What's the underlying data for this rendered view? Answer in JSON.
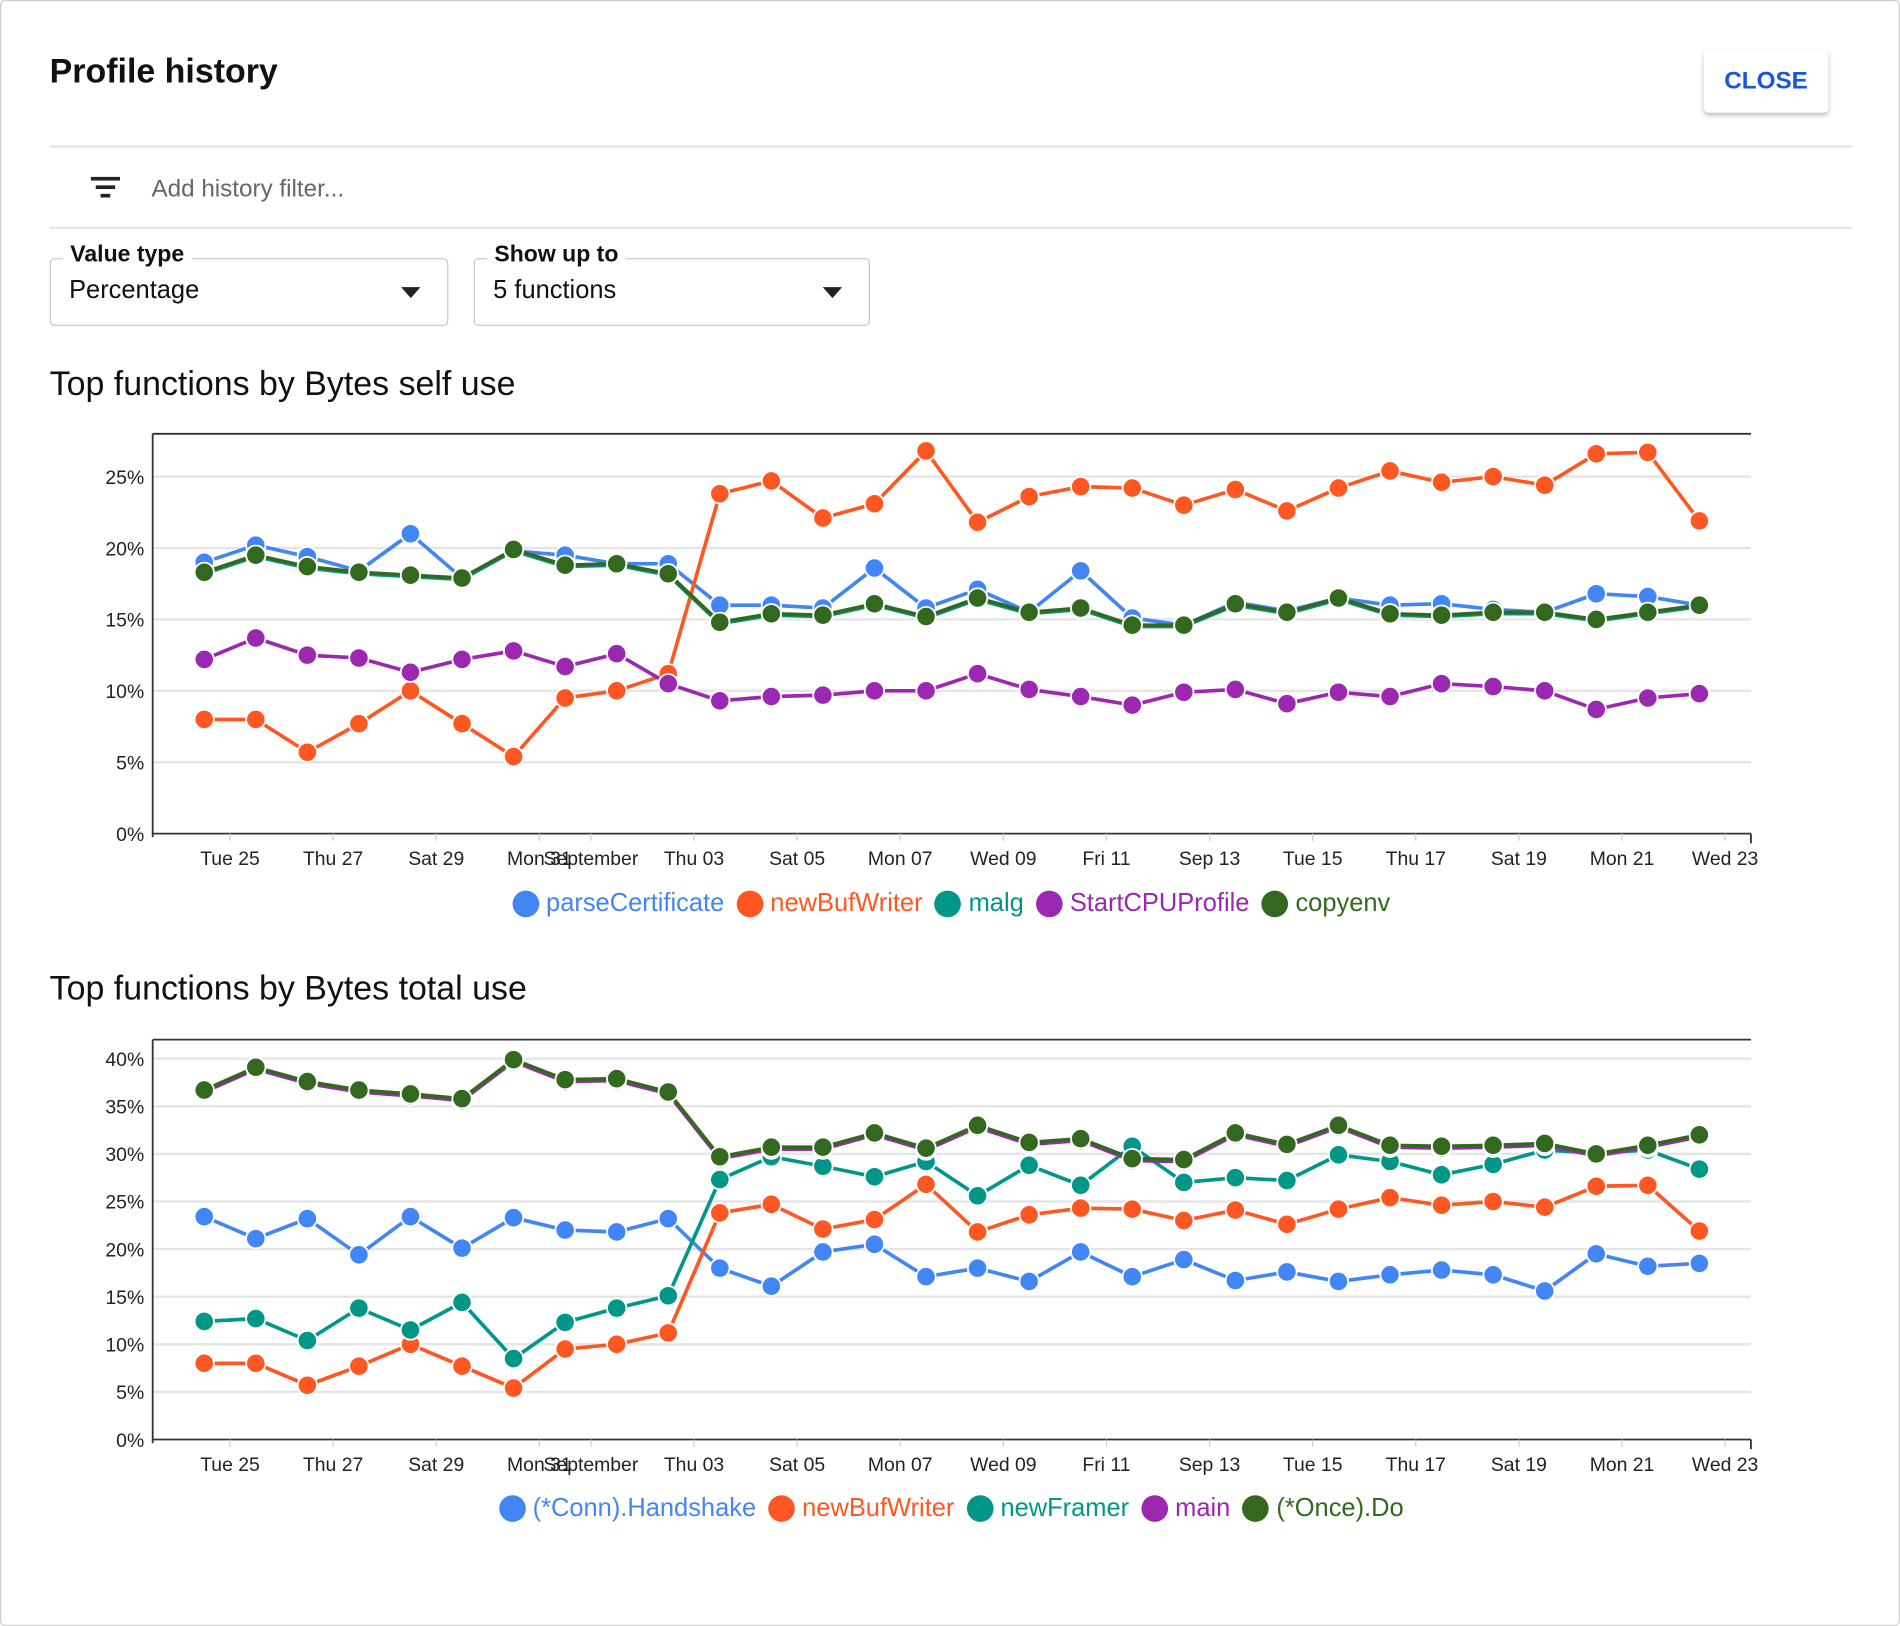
{
  "header": {
    "title": "Profile history",
    "close_label": "CLOSE"
  },
  "filter": {
    "icon": "filter-list-icon",
    "placeholder": "Add history filter..."
  },
  "controls": {
    "value_type": {
      "label": "Value type",
      "value": "Percentage"
    },
    "show_up_to": {
      "label": "Show up to",
      "value": "5 functions"
    }
  },
  "chart_data": [
    {
      "type": "line",
      "title": "Top functions by Bytes self use",
      "x": [
        "Aug 24",
        "Aug 25",
        "Aug 26",
        "Aug 27",
        "Aug 28",
        "Aug 29",
        "Aug 30",
        "Aug 31",
        "Sep 01",
        "Sep 02",
        "Sep 03",
        "Sep 04",
        "Sep 05",
        "Sep 06",
        "Sep 07",
        "Sep 08",
        "Sep 09",
        "Sep 10",
        "Sep 11",
        "Sep 12",
        "Sep 13",
        "Sep 14",
        "Sep 15",
        "Sep 16",
        "Sep 17",
        "Sep 18",
        "Sep 19",
        "Sep 20",
        "Sep 21",
        "Sep 22"
      ],
      "xticks": [
        "Tue 25",
        "Thu 27",
        "Sat 29",
        "Mon 31",
        "September",
        "Thu 03",
        "Sat 05",
        "Mon 07",
        "Wed 09",
        "Fri 11",
        "Sep 13",
        "Tue 15",
        "Thu 17",
        "Sat 19",
        "Mon 21",
        "Wed 23"
      ],
      "yticks": [
        "0%",
        "5%",
        "10%",
        "15%",
        "20%",
        "25%"
      ],
      "ylim": [
        0,
        28
      ],
      "grid": true,
      "legend": "bottom",
      "series": [
        {
          "name": "parseCertificate",
          "color": "#4285f4",
          "values": [
            19.0,
            20.2,
            19.4,
            18.4,
            21.0,
            17.9,
            19.8,
            19.5,
            18.9,
            18.9,
            16.0,
            16.0,
            15.8,
            18.6,
            15.8,
            17.1,
            15.5,
            18.4,
            15.1,
            14.6,
            16.2,
            15.6,
            16.5,
            16.0,
            16.1,
            15.7,
            15.5,
            16.8,
            16.6,
            16.0
          ]
        },
        {
          "name": "newBufWriter",
          "color": "#ff5722",
          "values": [
            8.0,
            8.0,
            5.7,
            7.7,
            10.0,
            7.7,
            5.4,
            9.5,
            10.0,
            11.2,
            23.8,
            24.7,
            22.1,
            23.1,
            26.8,
            21.8,
            23.6,
            24.3,
            24.2,
            23.0,
            24.1,
            22.6,
            24.2,
            25.4,
            24.6,
            25.0,
            24.4,
            26.6,
            26.7,
            21.9
          ]
        },
        {
          "name": "malg",
          "color": "#009688",
          "values": [
            18.2,
            19.4,
            18.6,
            18.2,
            18.0,
            17.8,
            19.8,
            18.7,
            18.8,
            18.1,
            14.7,
            15.3,
            15.2,
            16.0,
            15.1,
            16.4,
            15.4,
            15.7,
            14.5,
            14.5,
            16.0,
            15.4,
            16.4,
            15.3,
            15.2,
            15.4,
            15.4,
            14.9,
            15.4,
            15.9
          ]
        },
        {
          "name": "StartCPUProfile",
          "color": "#9c27b0",
          "values": [
            12.2,
            13.7,
            12.5,
            12.3,
            11.3,
            12.2,
            12.8,
            11.7,
            12.6,
            10.5,
            9.3,
            9.6,
            9.7,
            10.0,
            10.0,
            11.2,
            10.1,
            9.6,
            9.0,
            9.9,
            10.1,
            9.1,
            9.9,
            9.6,
            10.5,
            10.3,
            10.0,
            8.7,
            9.5,
            9.8
          ]
        },
        {
          "name": "copyenv",
          "color": "#33691e",
          "values": [
            18.3,
            19.5,
            18.7,
            18.3,
            18.1,
            17.9,
            19.9,
            18.8,
            18.9,
            18.2,
            14.8,
            15.4,
            15.3,
            16.1,
            15.2,
            16.5,
            15.5,
            15.8,
            14.6,
            14.6,
            16.1,
            15.5,
            16.5,
            15.4,
            15.3,
            15.5,
            15.5,
            15.0,
            15.5,
            16.0
          ]
        }
      ]
    },
    {
      "type": "line",
      "title": "Top functions by Bytes total use",
      "x": [
        "Aug 24",
        "Aug 25",
        "Aug 26",
        "Aug 27",
        "Aug 28",
        "Aug 29",
        "Aug 30",
        "Aug 31",
        "Sep 01",
        "Sep 02",
        "Sep 03",
        "Sep 04",
        "Sep 05",
        "Sep 06",
        "Sep 07",
        "Sep 08",
        "Sep 09",
        "Sep 10",
        "Sep 11",
        "Sep 12",
        "Sep 13",
        "Sep 14",
        "Sep 15",
        "Sep 16",
        "Sep 17",
        "Sep 18",
        "Sep 19",
        "Sep 20",
        "Sep 21",
        "Sep 22"
      ],
      "xticks": [
        "Tue 25",
        "Thu 27",
        "Sat 29",
        "Mon 31",
        "September",
        "Thu 03",
        "Sat 05",
        "Mon 07",
        "Wed 09",
        "Fri 11",
        "Sep 13",
        "Tue 15",
        "Thu 17",
        "Sat 19",
        "Mon 21",
        "Wed 23"
      ],
      "yticks": [
        "0%",
        "5%",
        "10%",
        "15%",
        "20%",
        "25%",
        "30%",
        "35%",
        "40%"
      ],
      "ylim": [
        0,
        42
      ],
      "grid": true,
      "legend": "bottom",
      "series": [
        {
          "name": "(*Conn).Handshake",
          "color": "#4285f4",
          "values": [
            23.4,
            21.1,
            23.2,
            19.4,
            23.4,
            20.1,
            23.3,
            22.0,
            21.8,
            23.2,
            18.0,
            16.1,
            19.7,
            20.5,
            17.1,
            18.0,
            16.6,
            19.7,
            17.1,
            18.9,
            16.7,
            17.6,
            16.6,
            17.3,
            17.8,
            17.3,
            15.6,
            19.5,
            18.2,
            18.5
          ]
        },
        {
          "name": "newBufWriter",
          "color": "#ff5722",
          "values": [
            8.0,
            8.0,
            5.7,
            7.7,
            10.0,
            7.7,
            5.4,
            9.5,
            10.0,
            11.2,
            23.8,
            24.7,
            22.1,
            23.1,
            26.8,
            21.8,
            23.6,
            24.3,
            24.2,
            23.0,
            24.1,
            22.6,
            24.2,
            25.4,
            24.6,
            25.0,
            24.4,
            26.6,
            26.7,
            21.9
          ]
        },
        {
          "name": "newFramer",
          "color": "#009688",
          "values": [
            12.4,
            12.7,
            10.4,
            13.8,
            11.5,
            14.4,
            8.5,
            12.3,
            13.8,
            15.1,
            27.3,
            29.7,
            28.7,
            27.6,
            29.2,
            25.6,
            28.8,
            26.7,
            30.8,
            27.0,
            27.5,
            27.2,
            29.9,
            29.2,
            27.8,
            28.9,
            30.4,
            30.1,
            30.4,
            28.4
          ]
        },
        {
          "name": "main",
          "color": "#9c27b0",
          "values": [
            36.5,
            38.9,
            37.4,
            36.5,
            36.1,
            35.6,
            39.7,
            37.6,
            37.7,
            36.3,
            29.5,
            30.5,
            30.5,
            32.0,
            30.4,
            32.8,
            31.0,
            31.4,
            29.3,
            29.2,
            32.0,
            30.8,
            32.8,
            30.7,
            30.6,
            30.7,
            30.9,
            29.8,
            30.7,
            31.8
          ]
        },
        {
          "name": "(*Once).Do",
          "color": "#33691e",
          "values": [
            36.7,
            39.1,
            37.6,
            36.7,
            36.3,
            35.8,
            39.9,
            37.8,
            37.9,
            36.5,
            29.7,
            30.7,
            30.7,
            32.2,
            30.6,
            33.0,
            31.2,
            31.6,
            29.5,
            29.4,
            32.2,
            31.0,
            33.0,
            30.9,
            30.8,
            30.9,
            31.1,
            30.0,
            30.9,
            32.0
          ]
        }
      ]
    }
  ]
}
